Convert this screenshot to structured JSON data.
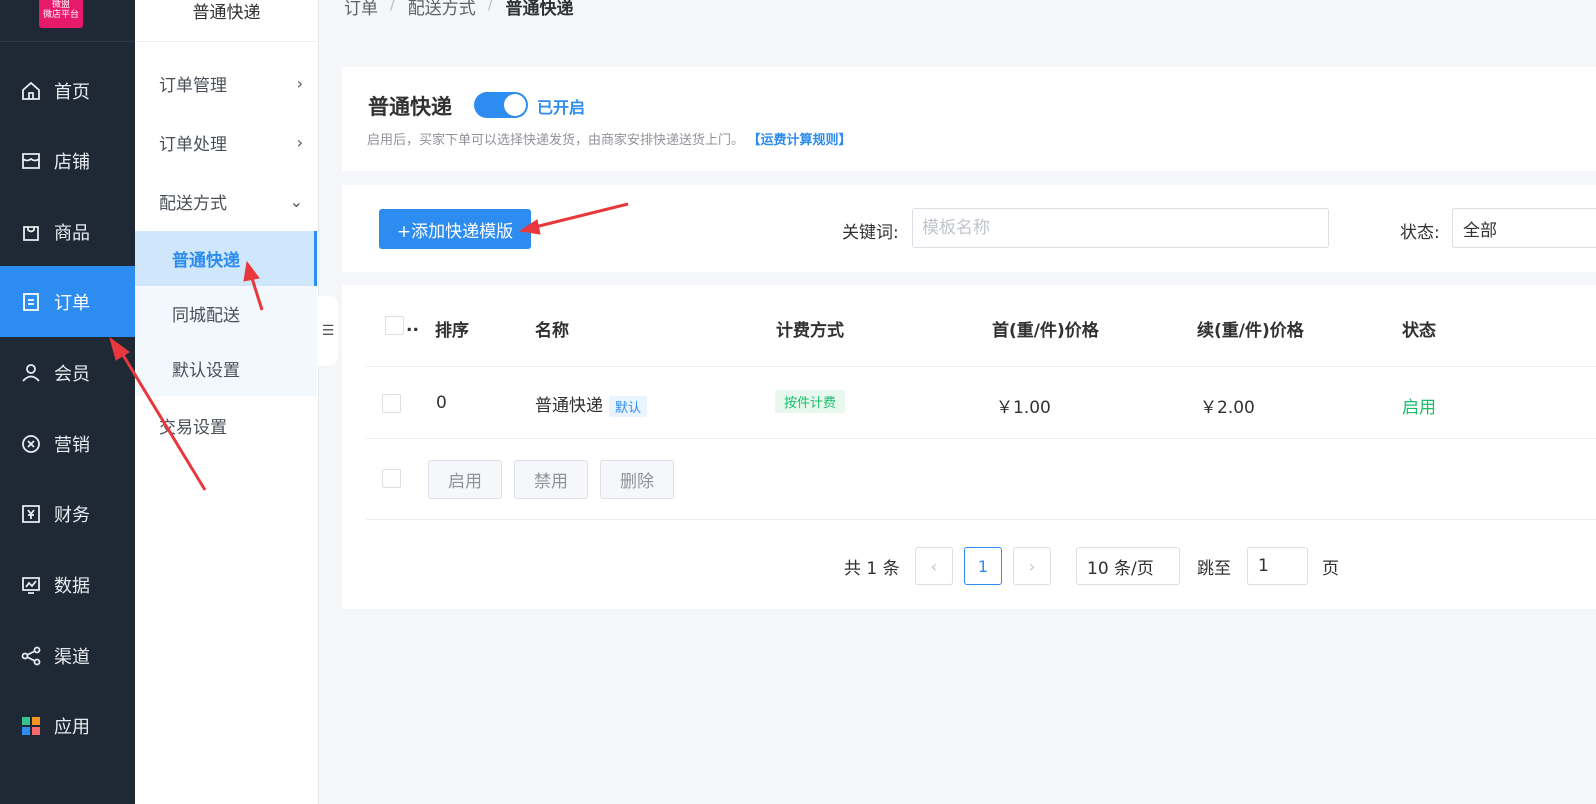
{
  "logo": {
    "line1": "微盟",
    "line2": "微店平台"
  },
  "nav": {
    "items": [
      {
        "label": "首页",
        "icon": "home-icon"
      },
      {
        "label": "店铺",
        "icon": "shop-icon"
      },
      {
        "label": "商品",
        "icon": "bag-icon"
      },
      {
        "label": "订单",
        "icon": "order-icon",
        "active": true
      },
      {
        "label": "会员",
        "icon": "user-icon"
      },
      {
        "label": "营销",
        "icon": "marketing-icon"
      },
      {
        "label": "财务",
        "icon": "finance-icon"
      },
      {
        "label": "数据",
        "icon": "chart-icon"
      },
      {
        "label": "渠道",
        "icon": "share-icon"
      },
      {
        "label": "应用",
        "icon": "apps-icon"
      }
    ]
  },
  "subnav": {
    "header": "普通快递",
    "groups": [
      {
        "label": "订单管理",
        "chevron": "›"
      },
      {
        "label": "订单处理",
        "chevron": "›"
      },
      {
        "label": "配送方式",
        "chevron": "⌄"
      },
      {
        "label": "交易设置"
      }
    ],
    "children": [
      {
        "label": "普通快递",
        "active": true
      },
      {
        "label": "同城配送"
      },
      {
        "label": "默认设置"
      }
    ],
    "collapse_icon": "menu-fold-icon"
  },
  "breadcrumb": [
    "订单",
    "配送方式",
    "普通快递"
  ],
  "express": {
    "title": "普通快递",
    "toggle_state": "已开启",
    "hint": "启用后，买家下单可以选择快递发货，由商家安排快递送货上门。",
    "rule_link": "【运费计算规则】"
  },
  "filter": {
    "add_button": "+添加快递模版",
    "keyword_label": "关键词:",
    "keyword_placeholder": "模板名称",
    "status_label": "状态:",
    "status_value": "全部"
  },
  "table": {
    "headers": [
      "..",
      "排序",
      "名称",
      "计费方式",
      "首(重/件)价格",
      "续(重/件)价格",
      "状态"
    ],
    "rows": [
      {
        "order": "0",
        "name": "普通快递",
        "tag": "默认",
        "fee": "按件计费",
        "first": "￥1.00",
        "next": "￥2.00",
        "status": "启用"
      }
    ],
    "batch": [
      "启用",
      "禁用",
      "删除"
    ]
  },
  "pagination": {
    "total": "共 1 条",
    "prev": "‹",
    "current": "1",
    "next": "›",
    "page_size": "10 条/页",
    "jump_label": "跳至",
    "jump_value": "1",
    "page_suffix": "页"
  }
}
